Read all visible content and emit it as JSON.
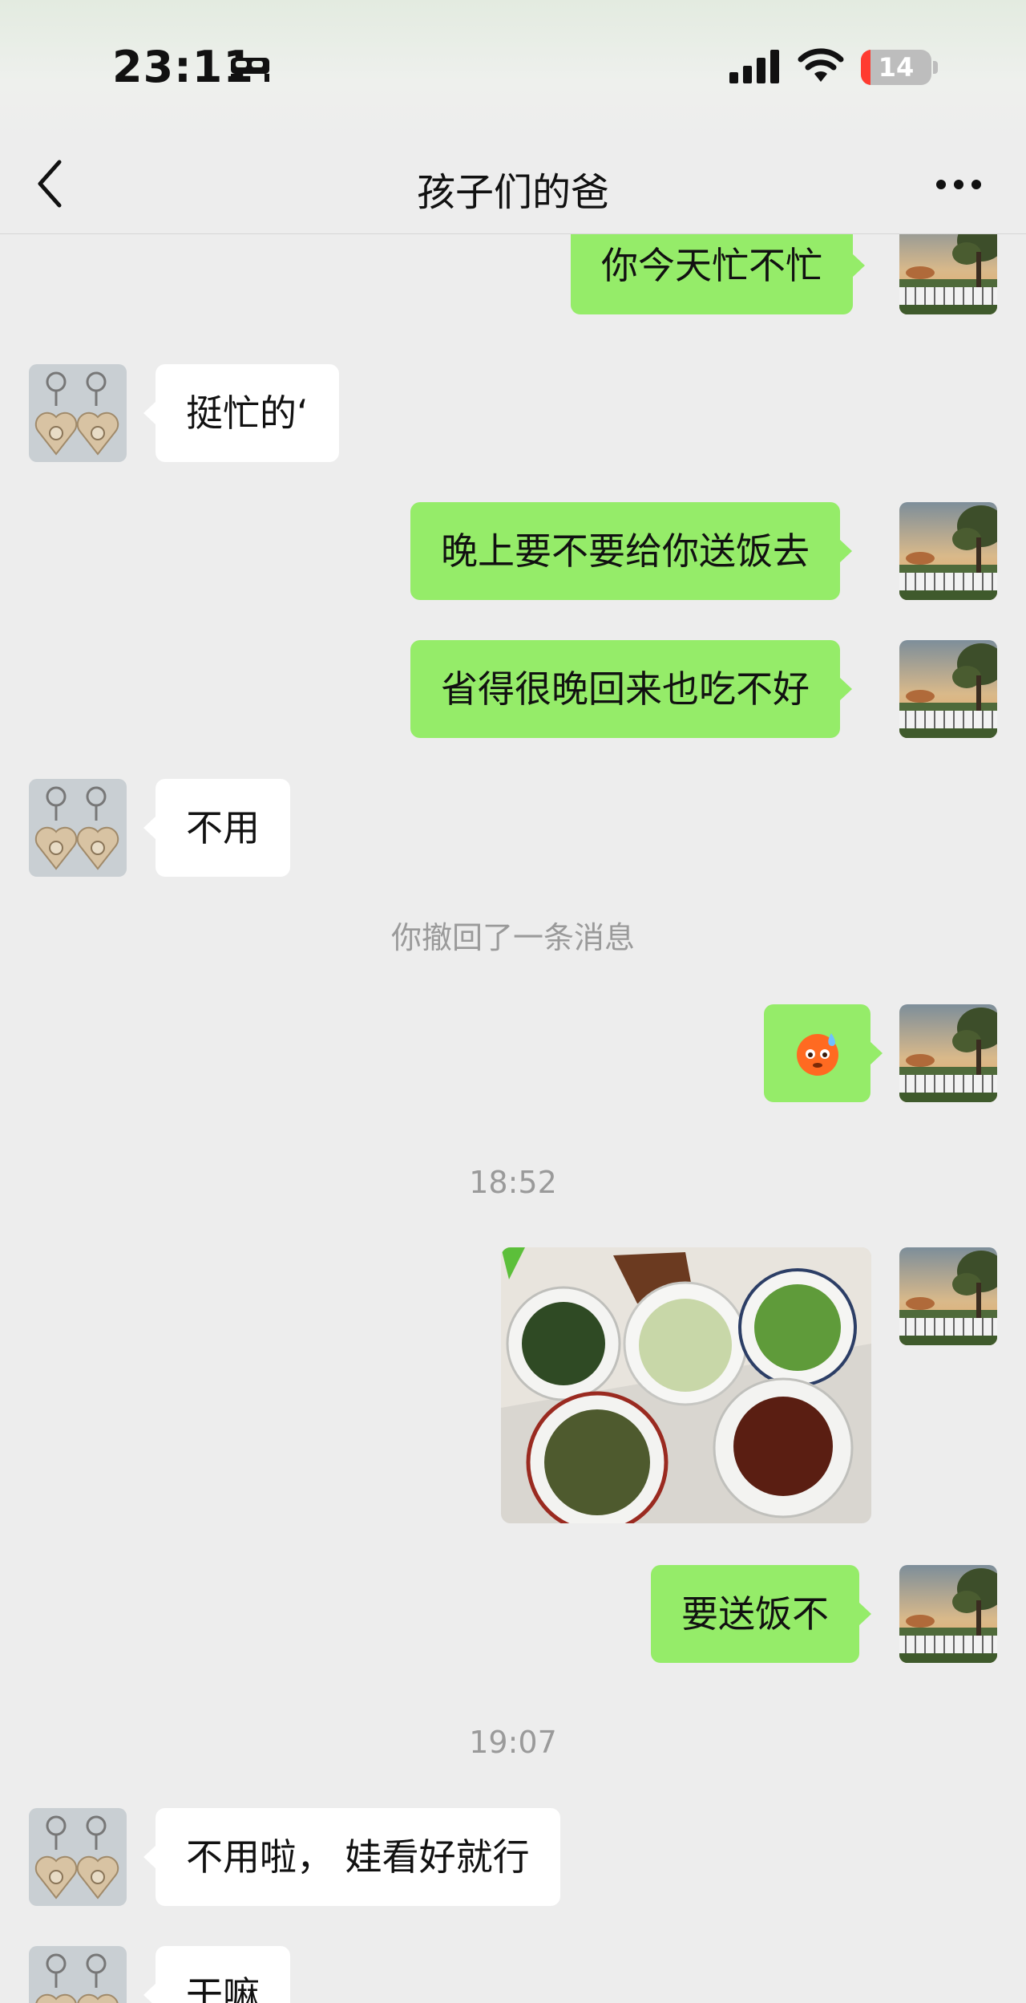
{
  "status": {
    "time": "23:11",
    "battery": "14",
    "battery_color": "#ff3b30",
    "battery_level": 0.14
  },
  "header": {
    "title": "孩子们的爸"
  },
  "messages": {
    "m1": "你今天忙不忙",
    "m2": "挺忙的‘",
    "m3": "晚上要不要给你送饭去",
    "m4": "省得很晚回来也吃不好",
    "m5": "不用",
    "recall": "你撤回了一条消息",
    "time1": "18:52",
    "m7": "要送饭不",
    "time2": "19:07",
    "m8": "不用啦， 娃看好就行",
    "m9": "干嘛"
  },
  "icons": {
    "back": "chevron-left-icon",
    "more": "more-dots-icon",
    "sleep": "bed-icon",
    "signal": "cellular-signal-icon",
    "wifi": "wifi-icon",
    "battery": "battery-icon",
    "emoji": "anxious-sweat-face-emoji"
  },
  "colors": {
    "my_bubble": "#95ec69",
    "their_bubble": "#ffffff",
    "background": "#ededed"
  }
}
